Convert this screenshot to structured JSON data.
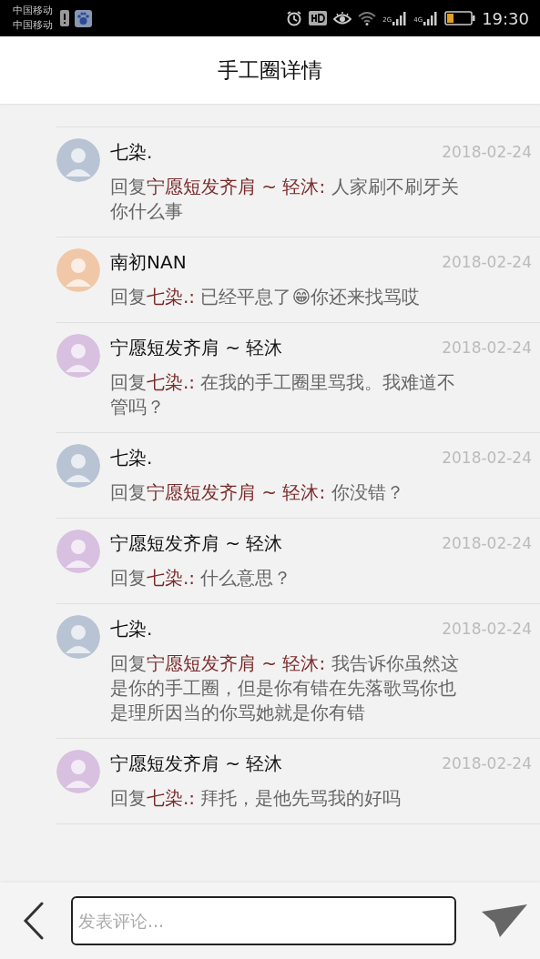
{
  "status_bar": {
    "carriers": [
      "中国移动",
      "中国移动"
    ],
    "network_labels": [
      "2G",
      "4G"
    ],
    "time": "19:30"
  },
  "header": {
    "title": "手工圈详情"
  },
  "comments": [
    {
      "name": "七染.",
      "color": "#b8c4d4",
      "date": "2018-02-24",
      "prefix": "回复",
      "target": "宁愿短发齐肩 ~ 轻沐:",
      "text": " 人家刷不刷牙关你什么事"
    },
    {
      "name": "南初NAN",
      "color": "#f0c8a8",
      "date": "2018-02-24",
      "prefix": "回复",
      "target": "七染.:",
      "text": " 已经平息了😁你还来找骂哎"
    },
    {
      "name": "宁愿短发齐肩 ~ 轻沐",
      "color": "#d8c0e0",
      "date": "2018-02-24",
      "prefix": "回复",
      "target": "七染.:",
      "text": " 在我的手工圈里骂我。我难道不管吗？"
    },
    {
      "name": "七染.",
      "color": "#b8c4d4",
      "date": "2018-02-24",
      "prefix": "回复",
      "target": "宁愿短发齐肩 ~ 轻沐:",
      "text": " 你没错？"
    },
    {
      "name": "宁愿短发齐肩 ~ 轻沐",
      "color": "#d8c0e0",
      "date": "2018-02-24",
      "prefix": "回复",
      "target": "七染.:",
      "text": " 什么意思？"
    },
    {
      "name": "七染.",
      "color": "#b8c4d4",
      "date": "2018-02-24",
      "prefix": "回复",
      "target": "宁愿短发齐肩 ~ 轻沐:",
      "text": " 我告诉你虽然这是你的手工圈，但是你有错在先落歌骂你也是理所因当的你骂她就是你有错"
    },
    {
      "name": "宁愿短发齐肩 ~ 轻沐",
      "color": "#d8c0e0",
      "date": "2018-02-24",
      "prefix": "回复",
      "target": "七染.:",
      "text": " 拜托，是他先骂我的好吗"
    }
  ],
  "composer": {
    "placeholder": "发表评论..."
  }
}
